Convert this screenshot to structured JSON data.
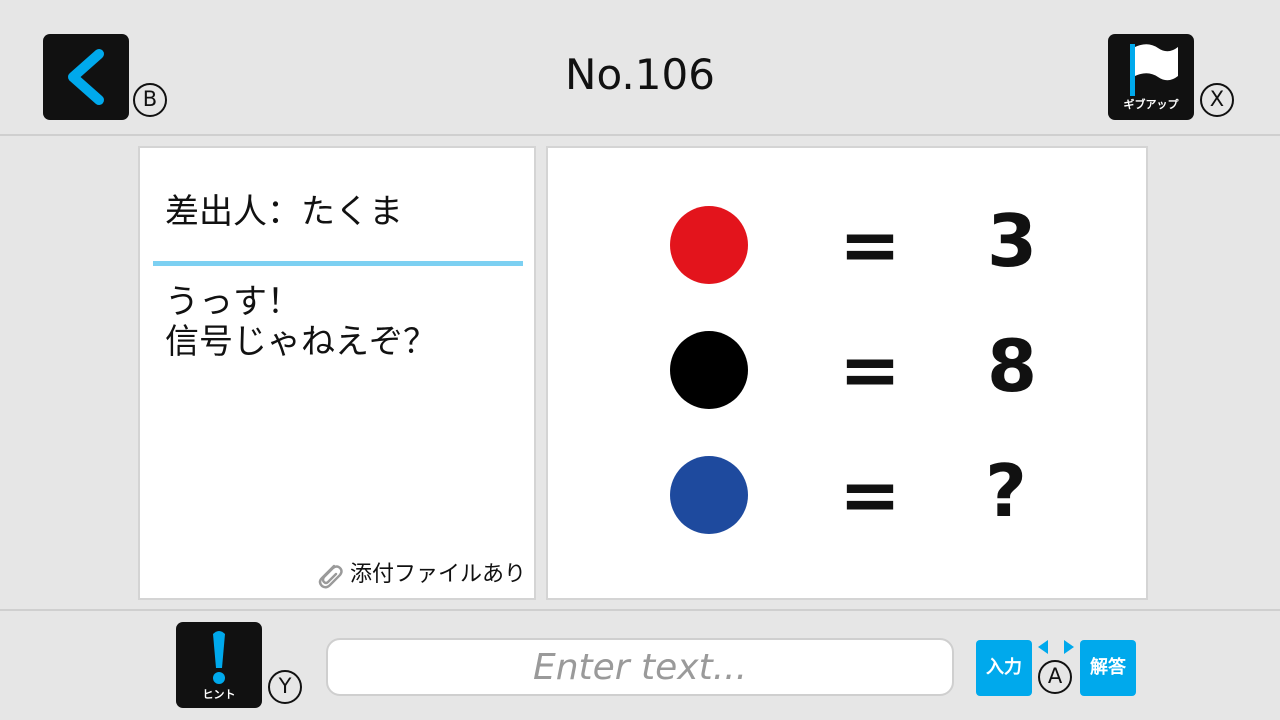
{
  "header": {
    "back_badge": "B",
    "puzzle_number": "No.106",
    "giveup_label": "ギブアップ",
    "giveup_badge": "X"
  },
  "message_panel": {
    "sender": "差出人：たくま",
    "message_lines": [
      "うっす！",
      "信号じゃねえぞ？"
    ],
    "attachment_label": "添付ファイルあり"
  },
  "puzzle": {
    "rows": [
      {
        "color": "#e3141c",
        "equals": "=",
        "value": "3"
      },
      {
        "color": "#000000",
        "equals": "=",
        "value": "8"
      },
      {
        "color": "#1e4a9e",
        "equals": "=",
        "value": "?"
      }
    ]
  },
  "footer": {
    "hint_label": "ヒント",
    "hint_badge": "Y",
    "input_placeholder": "Enter text...",
    "input_button": "入力",
    "toggle_badge": "A",
    "answer_button": "解答"
  },
  "colors": {
    "accent": "#00a9ec",
    "line": "#7cd0f2"
  }
}
